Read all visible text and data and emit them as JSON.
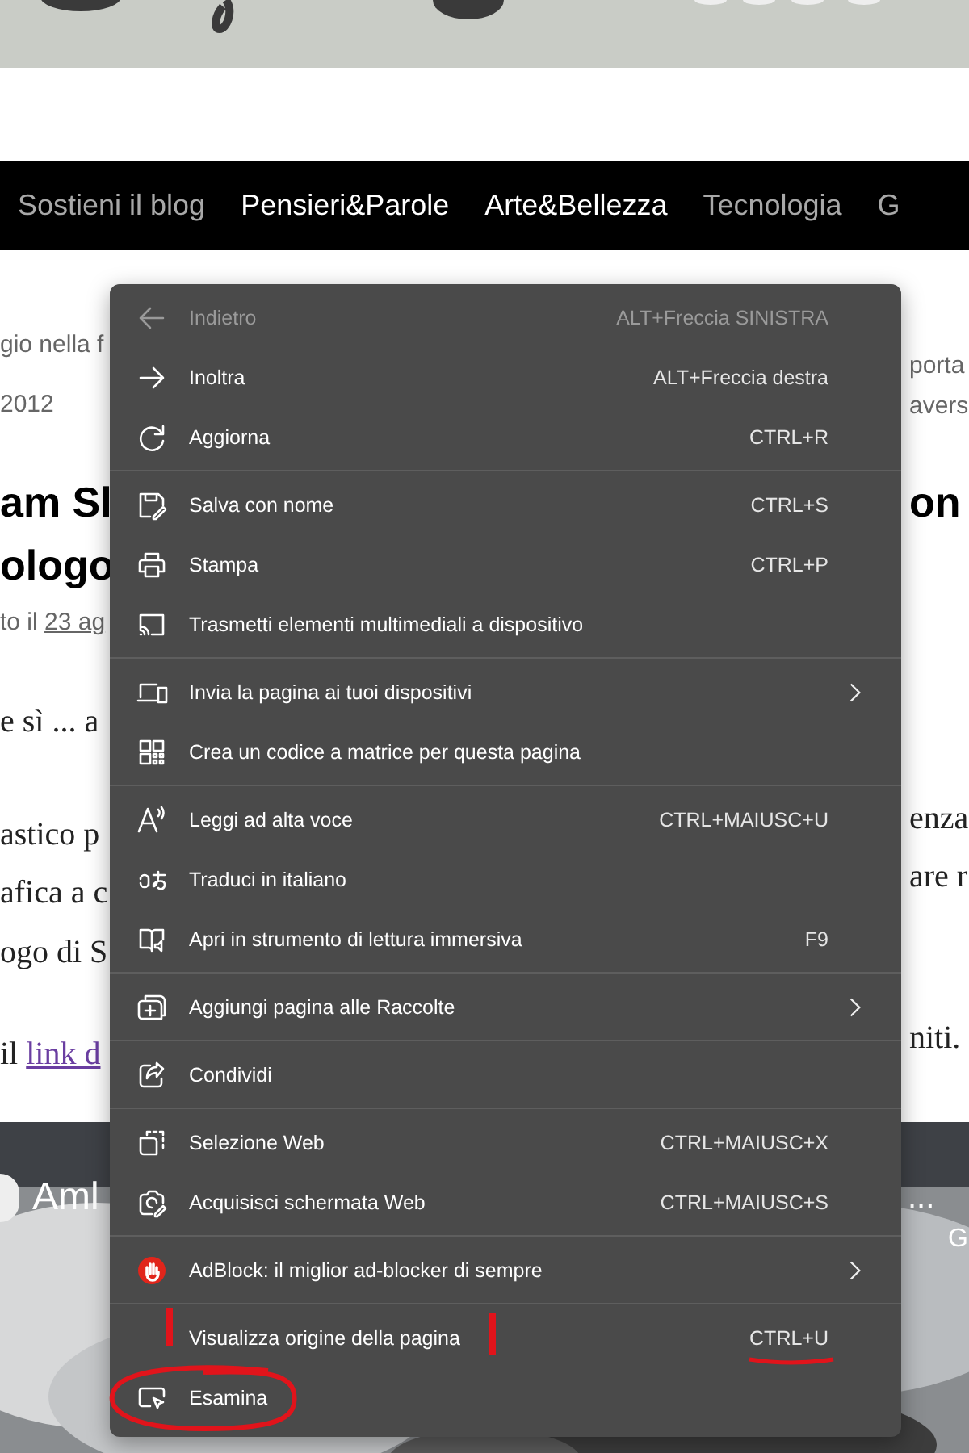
{
  "nav": [
    {
      "label": "Sostieni il blog",
      "active": false
    },
    {
      "label": "Pensieri&Parole",
      "active": true
    },
    {
      "label": "Arte&Bellezza",
      "active": true
    },
    {
      "label": "Tecnologia",
      "active": false
    },
    {
      "label": "G",
      "active": false
    }
  ],
  "article_left": [
    {
      "kind": "meta",
      "text": "gio nella f"
    },
    {
      "kind": "meta",
      "text": "2012"
    },
    {
      "kind": "heading",
      "text": "am Sl"
    },
    {
      "kind": "heading",
      "text": "ologo"
    },
    {
      "kind": "meta",
      "text": "to il ",
      "link": "23 ag"
    },
    {
      "kind": "body",
      "text": "e sì ... a"
    },
    {
      "kind": "body",
      "text": "astico p"
    },
    {
      "kind": "body",
      "text": "afica a c"
    },
    {
      "kind": "body",
      "text": "ogo di S"
    },
    {
      "kind": "body",
      "text": "il ",
      "link": "link d"
    }
  ],
  "article_right": [
    {
      "kind": "meta",
      "text": "porta"
    },
    {
      "kind": "meta",
      "text": "avers"
    },
    {
      "kind": "heading",
      "text": "on"
    },
    {
      "kind": "body",
      "text": "enza"
    },
    {
      "kind": "body",
      "text": "are r"
    },
    {
      "kind": "body",
      "text": "niti."
    }
  ],
  "video": {
    "title": "Aml",
    "more": "...",
    "side_label": "G"
  },
  "context_menu": {
    "groups": [
      {
        "items": [
          {
            "label": "Indietro",
            "shortcut": "ALT+Freccia SINISTRA",
            "disabled": true
          },
          {
            "label": "Inoltra",
            "shortcut": "ALT+Freccia destra",
            "disabled": false
          },
          {
            "label": "Aggiorna",
            "shortcut": "CTRL+R",
            "disabled": false
          }
        ]
      },
      {
        "items": [
          {
            "label": "Salva con nome",
            "shortcut": "CTRL+S",
            "disabled": false
          },
          {
            "label": "Stampa",
            "shortcut": "CTRL+P",
            "disabled": false
          },
          {
            "label": "Trasmetti elementi multimediali a dispositivo",
            "disabled": false
          }
        ]
      },
      {
        "items": [
          {
            "label": "Invia la pagina ai tuoi dispositivi",
            "submenu": true,
            "disabled": false
          },
          {
            "label": "Crea un codice a matrice per questa pagina",
            "disabled": false
          }
        ]
      },
      {
        "items": [
          {
            "label": "Leggi ad alta voce",
            "shortcut": "CTRL+MAIUSC+U",
            "disabled": false
          },
          {
            "label": "Traduci in italiano",
            "disabled": false
          },
          {
            "label": "Apri in strumento di lettura immersiva",
            "shortcut": "F9",
            "disabled": false
          }
        ]
      },
      {
        "items": [
          {
            "label": "Aggiungi pagina alle Raccolte",
            "submenu": true,
            "disabled": false
          }
        ]
      },
      {
        "items": [
          {
            "label": "Condividi",
            "disabled": false
          }
        ]
      },
      {
        "items": [
          {
            "label": "Selezione Web",
            "shortcut": "CTRL+MAIUSC+X",
            "disabled": false
          },
          {
            "label": "Acquisisci schermata Web",
            "shortcut": "CTRL+MAIUSC+S",
            "disabled": false
          }
        ]
      },
      {
        "items": [
          {
            "label": "AdBlock: il miglior ad-blocker di sempre",
            "submenu": true,
            "disabled": false
          }
        ]
      },
      {
        "items": [
          {
            "label": "Visualizza origine della pagina",
            "shortcut": "CTRL+U",
            "disabled": false
          },
          {
            "label": "Esamina",
            "disabled": false
          }
        ]
      }
    ]
  }
}
